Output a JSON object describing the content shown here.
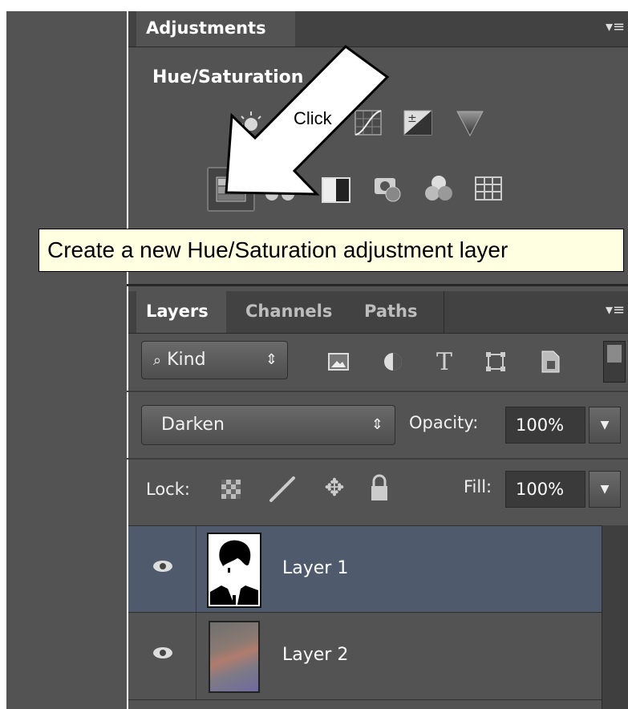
{
  "adjustments": {
    "tab": "Adjustments",
    "title": "Hue/Saturation",
    "icons_row1": [
      "brightness-contrast-icon",
      "levels-icon",
      "curves-icon",
      "exposure-icon",
      "vibrance-icon"
    ],
    "icons_row2": [
      "hue-saturation-icon",
      "color-balance-icon",
      "black-white-icon",
      "photo-filter-icon",
      "channel-mixer-icon",
      "color-lookup-icon"
    ],
    "tooltip": "Create a new Hue/Saturation adjustment layer"
  },
  "annotation": {
    "label": "Click"
  },
  "layers_panel": {
    "tabs": [
      "Layers",
      "Channels",
      "Paths"
    ],
    "kind": "Kind",
    "blend_mode": "Darken",
    "opacity_label": "Opacity:",
    "opacity": "100%",
    "lock_label": "Lock:",
    "fill_label": "Fill:",
    "fill": "100%",
    "layers": [
      {
        "name": "Layer 1",
        "selected": true
      },
      {
        "name": "Layer 2",
        "selected": false
      }
    ]
  },
  "colors": {
    "panel": "#535353",
    "selected_row": "#4f5b6d",
    "tooltip": "#ffffe1"
  }
}
